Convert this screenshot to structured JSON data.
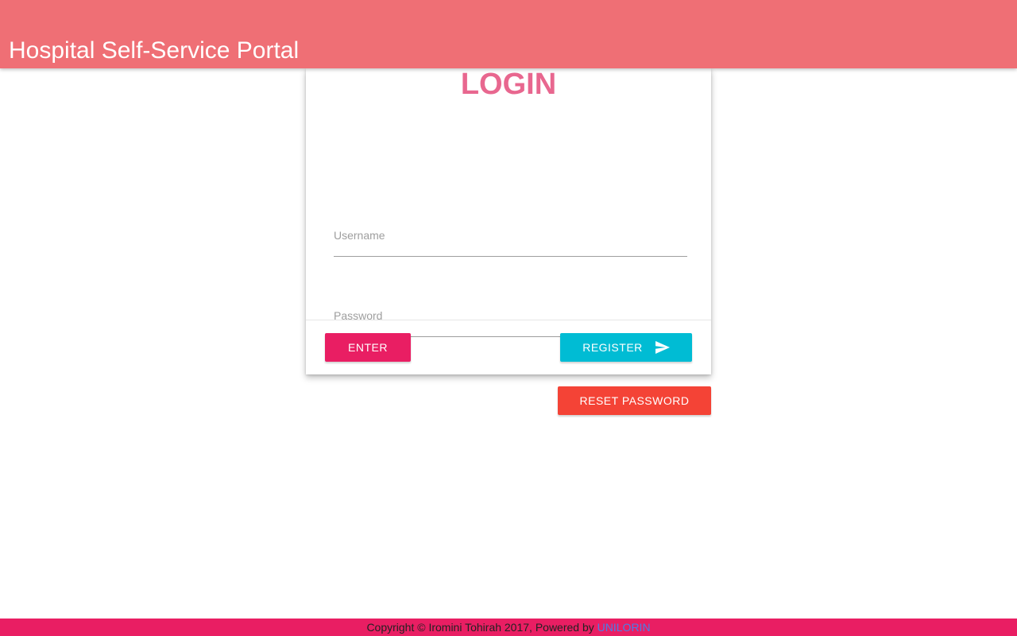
{
  "header": {
    "title": "Hospital Self-Service Portal",
    "background_color": "#ef6f75"
  },
  "login_card": {
    "title": "LOGIN",
    "title_color": "#e8678f",
    "username": {
      "placeholder": "Username",
      "value": ""
    },
    "password": {
      "placeholder": "Password",
      "value": ""
    },
    "enter_label": "ENTER",
    "register_label": "REGISTER",
    "register_icon": "send-icon"
  },
  "reset_password_label": "RESET PASSWORD",
  "footer": {
    "text": "Copyright © Iromini Tohirah 2017, Powered by ",
    "link_label": "UNILORIN",
    "background_color": "#e91e63"
  },
  "colors": {
    "enter_button": "#e91e63",
    "register_button": "#00bcd4",
    "reset_button": "#f44336",
    "link": "#4a7fe8"
  }
}
